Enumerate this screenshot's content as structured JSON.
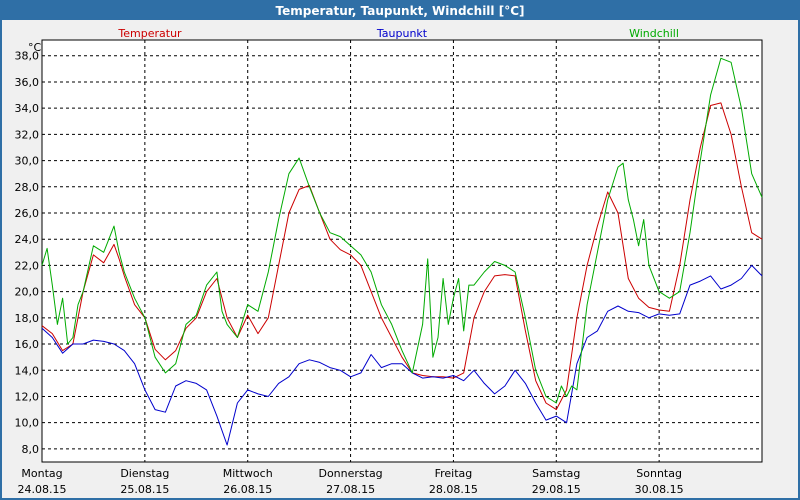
{
  "window": {
    "title": "Temperatur, Taupunkt, Windchill [°C]"
  },
  "chart_data": {
    "type": "line",
    "title": "Temperatur, Taupunkt, Windchill [°C]",
    "ylabel": "°C",
    "ylim": [
      7,
      39.2
    ],
    "xlim": [
      0,
      7
    ],
    "grid": true,
    "y_ticks": [
      "8,0",
      "10,0",
      "12,0",
      "14,0",
      "16,0",
      "18,0",
      "20,0",
      "22,0",
      "24,0",
      "26,0",
      "28,0",
      "30,0",
      "32,0",
      "34,0",
      "36,0",
      "38,0"
    ],
    "x_ticks": [
      {
        "day": "Montag",
        "date": "24.08.15"
      },
      {
        "day": "Dienstag",
        "date": "25.08.15"
      },
      {
        "day": "Mittwoch",
        "date": "26.08.15"
      },
      {
        "day": "Donnerstag",
        "date": "27.08.15"
      },
      {
        "day": "Freitag",
        "date": "28.08.15"
      },
      {
        "day": "Samstag",
        "date": "29.08.15"
      },
      {
        "day": "Sonntag",
        "date": "30.08.15"
      }
    ],
    "series": [
      {
        "name": "Temperatur",
        "color": "#cc0000",
        "x": [
          0,
          0.1,
          0.2,
          0.3,
          0.4,
          0.5,
          0.6,
          0.7,
          0.75,
          0.8,
          0.9,
          1.0,
          1.1,
          1.2,
          1.3,
          1.4,
          1.5,
          1.6,
          1.7,
          1.8,
          1.9,
          2.0,
          2.1,
          2.2,
          2.3,
          2.4,
          2.5,
          2.6,
          2.7,
          2.8,
          2.9,
          3.0,
          3.1,
          3.2,
          3.3,
          3.4,
          3.5,
          3.6,
          3.7,
          3.8,
          3.9,
          4.0,
          4.1,
          4.2,
          4.3,
          4.4,
          4.5,
          4.6,
          4.7,
          4.8,
          4.9,
          5.0,
          5.1,
          5.2,
          5.3,
          5.4,
          5.5,
          5.6,
          5.7,
          5.8,
          5.9,
          6.0,
          6.1,
          6.2,
          6.3,
          6.4,
          6.5,
          6.6,
          6.7,
          6.8,
          6.9,
          7.0
        ],
        "values": [
          17.4,
          16.8,
          15.5,
          16.0,
          20.0,
          22.8,
          22.2,
          23.6,
          22.5,
          21.2,
          19.0,
          18.0,
          15.6,
          14.8,
          15.5,
          17.2,
          18.0,
          20.0,
          21.0,
          18.0,
          16.5,
          18.2,
          16.8,
          18.0,
          22.0,
          26.0,
          27.8,
          28.1,
          26.0,
          24.0,
          23.2,
          22.8,
          22.0,
          20.0,
          18.0,
          16.5,
          15.0,
          13.8,
          13.6,
          13.5,
          13.5,
          13.4,
          13.8,
          18.0,
          20.0,
          21.2,
          21.3,
          21.2,
          17.0,
          13.2,
          11.5,
          11.0,
          12.5,
          18.0,
          22.0,
          25.0,
          27.6,
          26.0,
          21.0,
          19.5,
          18.8,
          18.6,
          18.5,
          22.0,
          27.0,
          31.0,
          34.2,
          34.4,
          32.0,
          28.0,
          24.5,
          24.0
        ]
      },
      {
        "name": "Taupunkt",
        "color": "#0000cc",
        "x": [
          0,
          0.1,
          0.2,
          0.3,
          0.4,
          0.5,
          0.6,
          0.7,
          0.8,
          0.9,
          1.0,
          1.1,
          1.2,
          1.3,
          1.4,
          1.5,
          1.6,
          1.7,
          1.8,
          1.9,
          2.0,
          2.1,
          2.2,
          2.3,
          2.4,
          2.5,
          2.6,
          2.7,
          2.8,
          2.9,
          3.0,
          3.1,
          3.2,
          3.3,
          3.4,
          3.5,
          3.6,
          3.7,
          3.8,
          3.9,
          4.0,
          4.1,
          4.2,
          4.3,
          4.4,
          4.5,
          4.6,
          4.7,
          4.8,
          4.9,
          5.0,
          5.1,
          5.2,
          5.3,
          5.4,
          5.5,
          5.6,
          5.7,
          5.8,
          5.9,
          6.0,
          6.1,
          6.2,
          6.3,
          6.4,
          6.5,
          6.6,
          6.7,
          6.8,
          6.9,
          7.0
        ],
        "values": [
          17.2,
          16.5,
          15.3,
          16.0,
          16.0,
          16.3,
          16.2,
          16.0,
          15.5,
          14.5,
          12.5,
          11.0,
          10.8,
          12.8,
          13.2,
          13.0,
          12.5,
          10.5,
          8.3,
          11.5,
          12.5,
          12.2,
          12.0,
          13.0,
          13.5,
          14.5,
          14.8,
          14.6,
          14.2,
          14.0,
          13.5,
          13.8,
          15.2,
          14.2,
          14.5,
          14.5,
          13.8,
          13.4,
          13.5,
          13.4,
          13.6,
          13.2,
          14.0,
          13.0,
          12.2,
          12.8,
          14.0,
          13.0,
          11.5,
          10.2,
          10.5,
          10.0,
          14.5,
          16.5,
          17.0,
          18.5,
          18.9,
          18.5,
          18.4,
          18.0,
          18.3,
          18.2,
          18.3,
          20.5,
          20.8,
          21.2,
          20.2,
          20.5,
          21.0,
          22.0,
          21.2
        ]
      },
      {
        "name": "Windchill",
        "color": "#00aa00",
        "x": [
          0,
          0.05,
          0.1,
          0.15,
          0.2,
          0.25,
          0.3,
          0.35,
          0.4,
          0.5,
          0.6,
          0.7,
          0.75,
          0.8,
          0.9,
          1.0,
          1.1,
          1.2,
          1.3,
          1.4,
          1.5,
          1.6,
          1.7,
          1.75,
          1.8,
          1.9,
          2.0,
          2.1,
          2.2,
          2.3,
          2.4,
          2.5,
          2.6,
          2.7,
          2.8,
          2.9,
          3.0,
          3.1,
          3.2,
          3.3,
          3.4,
          3.5,
          3.6,
          3.7,
          3.75,
          3.8,
          3.85,
          3.9,
          3.95,
          4.0,
          4.05,
          4.1,
          4.15,
          4.2,
          4.3,
          4.4,
          4.5,
          4.6,
          4.7,
          4.8,
          4.9,
          5.0,
          5.05,
          5.1,
          5.15,
          5.2,
          5.3,
          5.4,
          5.5,
          5.6,
          5.65,
          5.7,
          5.75,
          5.8,
          5.85,
          5.9,
          6.0,
          6.1,
          6.2,
          6.3,
          6.4,
          6.5,
          6.6,
          6.7,
          6.8,
          6.9,
          7.0
        ],
        "values": [
          22.0,
          23.3,
          20.5,
          17.5,
          19.5,
          16.0,
          16.5,
          19.0,
          20.0,
          23.5,
          23.0,
          25.0,
          23.0,
          21.5,
          19.5,
          18.0,
          15.0,
          13.8,
          14.5,
          17.5,
          18.2,
          20.5,
          21.5,
          18.5,
          17.5,
          16.5,
          19.0,
          18.5,
          21.5,
          25.5,
          29.0,
          30.2,
          28.0,
          26.0,
          24.5,
          24.2,
          23.5,
          22.8,
          21.5,
          19.0,
          17.5,
          15.5,
          13.8,
          17.5,
          22.5,
          15.0,
          16.5,
          21.0,
          17.5,
          19.5,
          21.0,
          17.0,
          20.5,
          20.5,
          21.5,
          22.3,
          22.0,
          21.5,
          18.0,
          14.0,
          12.0,
          11.5,
          12.8,
          12.0,
          12.8,
          12.5,
          19.0,
          23.0,
          27.0,
          29.5,
          29.8,
          27.0,
          25.5,
          23.5,
          25.5,
          22.0,
          20.0,
          19.5,
          20.0,
          24.5,
          30.0,
          35.0,
          37.8,
          37.5,
          34.0,
          29.0,
          27.2
        ]
      }
    ]
  }
}
